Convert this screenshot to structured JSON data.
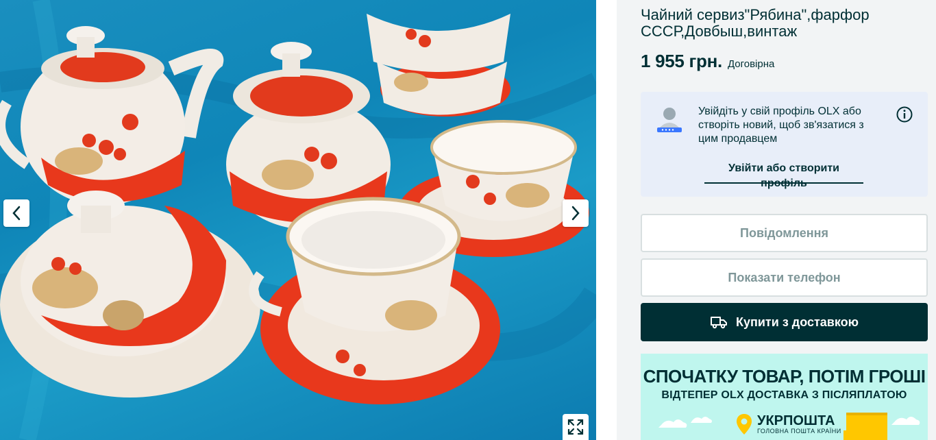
{
  "gallery": {
    "prev_icon": "chevron-left-icon",
    "next_icon": "chevron-right-icon",
    "fullscreen_icon": "expand-icon"
  },
  "listing": {
    "title": "Чайний сервиз\"Рябина\",фарфор СССР,Довбыш,винтаж",
    "price": "1 955 грн.",
    "negotiable": "Договірна"
  },
  "login_prompt": {
    "text": "Увійдіть у свій профіль OLX або створіть новий, щоб зв'язатися з цим продавцем",
    "link": "Увійти або створити профіль",
    "info_icon": "info-icon"
  },
  "actions": {
    "message": "Повідомлення",
    "show_phone": "Показати телефон",
    "buy_delivery": "Купити з доставкою",
    "buy_icon": "delivery-truck-icon"
  },
  "banner": {
    "headline": "СПОЧАТКУ ТОВАР, ПОТІМ ГРОШІ",
    "subline": "ВІДТЕПЕР OLX ДОСТАВКА З ПІСЛЯПЛАТОЮ",
    "brand_name": "УКРПОШТА",
    "brand_tagline": "ГОЛОВНА ПОШТА КРАЇНИ",
    "colors": {
      "background": "#bff6ee",
      "accent": "#ffc700"
    }
  },
  "colors": {
    "primary": "#002f34",
    "card": "#e8eef9",
    "border": "#d8dfe0",
    "muted_text": "#7f9799"
  }
}
